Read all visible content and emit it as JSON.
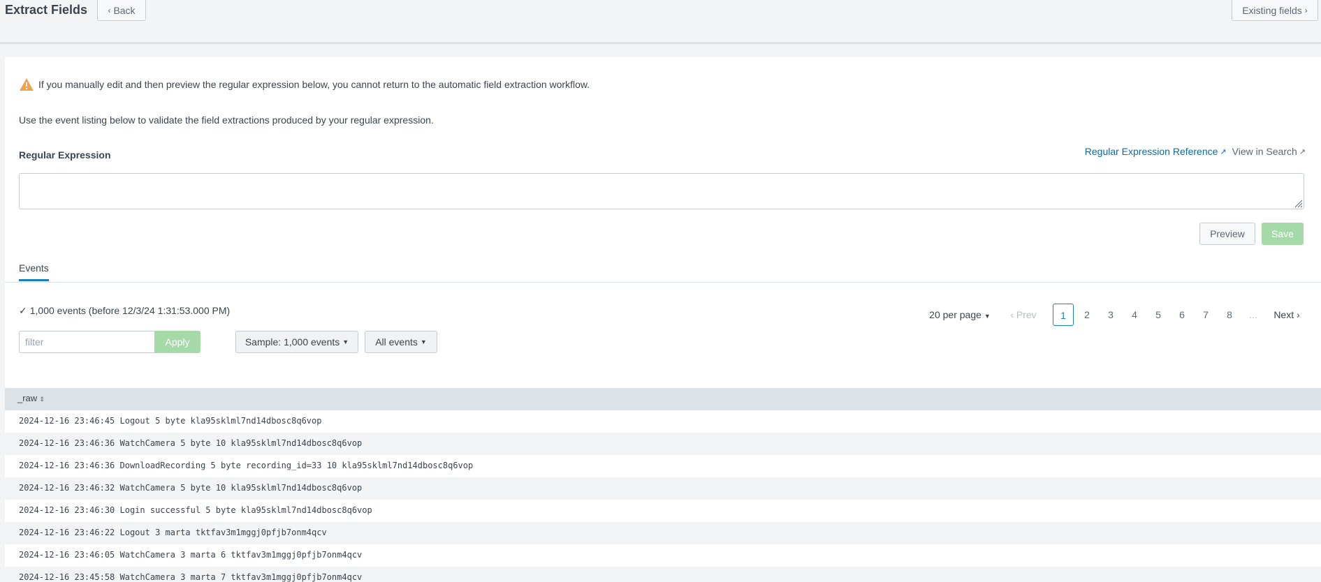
{
  "header": {
    "title": "Extract Fields",
    "back_label": "Back",
    "existing_fields_label": "Existing fields"
  },
  "warning": {
    "text": "If you manually edit and then preview the regular expression below, you cannot return to the automatic field extraction workflow.",
    "icon": "warning-icon",
    "color": "#f0a24e"
  },
  "info_text": "Use the event listing below to validate the field extractions produced by your regular expression.",
  "regex": {
    "label": "Regular Expression",
    "reference_link": "Regular Expression Reference",
    "view_link": "View in Search",
    "value": ""
  },
  "actions": {
    "preview_label": "Preview",
    "save_label": "Save"
  },
  "tabs": {
    "events_label": "Events"
  },
  "events": {
    "count_text": "1,000 events (before 12/3/24 1:31:53.000 PM)",
    "filter_placeholder": "filter",
    "apply_label": "Apply",
    "sample_label": "Sample: 1,000 events",
    "all_events_label": "All events"
  },
  "pager": {
    "per_page": "20 per page",
    "prev": "Prev",
    "pages": [
      "1",
      "2",
      "3",
      "4",
      "5",
      "6",
      "7",
      "8"
    ],
    "current": "1",
    "ellipsis": "...",
    "next": "Next"
  },
  "table": {
    "column": "_raw",
    "rows": [
      "2024-12-16 23:46:45 Logout 5 byte kla95sklml7nd14dbosc8q6vop",
      "2024-12-16 23:46:36 WatchCamera 5 byte 10 kla95sklml7nd14dbosc8q6vop",
      "2024-12-16 23:46:36 DownloadRecording 5 byte recording_id=33 10 kla95sklml7nd14dbosc8q6vop",
      "2024-12-16 23:46:32 WatchCamera 5 byte 10 kla95sklml7nd14dbosc8q6vop",
      "2024-12-16 23:46:30 Login successful 5 byte kla95sklml7nd14dbosc8q6vop",
      "2024-12-16 23:46:22 Logout 3 marta tktfav3m1mggj0pfjb7onm4qcv",
      "2024-12-16 23:46:05 WatchCamera 3 marta 6 tktfav3m1mggj0pfjb7onm4qcv",
      "2024-12-16 23:45:58 WatchCamera 3 marta 7 tktfav3m1mggj0pfjb7onm4qcv"
    ]
  },
  "colors": {
    "accent": "#1a7fc1",
    "link": "#006eaa",
    "save_disabled": "#a6d9a8"
  }
}
